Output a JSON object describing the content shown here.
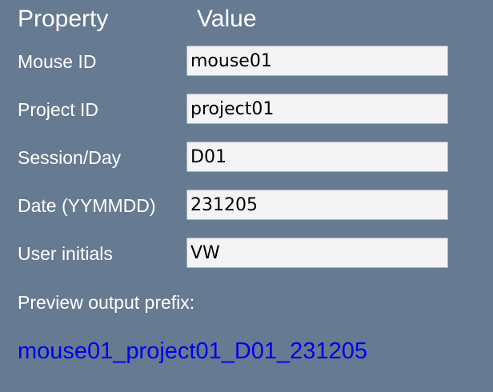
{
  "header": {
    "property_label": "Property",
    "value_label": "Value"
  },
  "fields": {
    "mouse_id": {
      "label": "Mouse ID",
      "value": "mouse01"
    },
    "project_id": {
      "label": "Project ID",
      "value": "project01"
    },
    "session_day": {
      "label": "Session/Day",
      "value": "D01"
    },
    "date": {
      "label": "Date (YYMMDD)",
      "value": "231205"
    },
    "user_initials": {
      "label": "User initials",
      "value": "VW"
    }
  },
  "preview": {
    "label": "Preview output prefix:",
    "value": "mouse01_project01_D01_231205"
  },
  "colors": {
    "background": "#667a91",
    "preview_text": "#0000ee"
  }
}
